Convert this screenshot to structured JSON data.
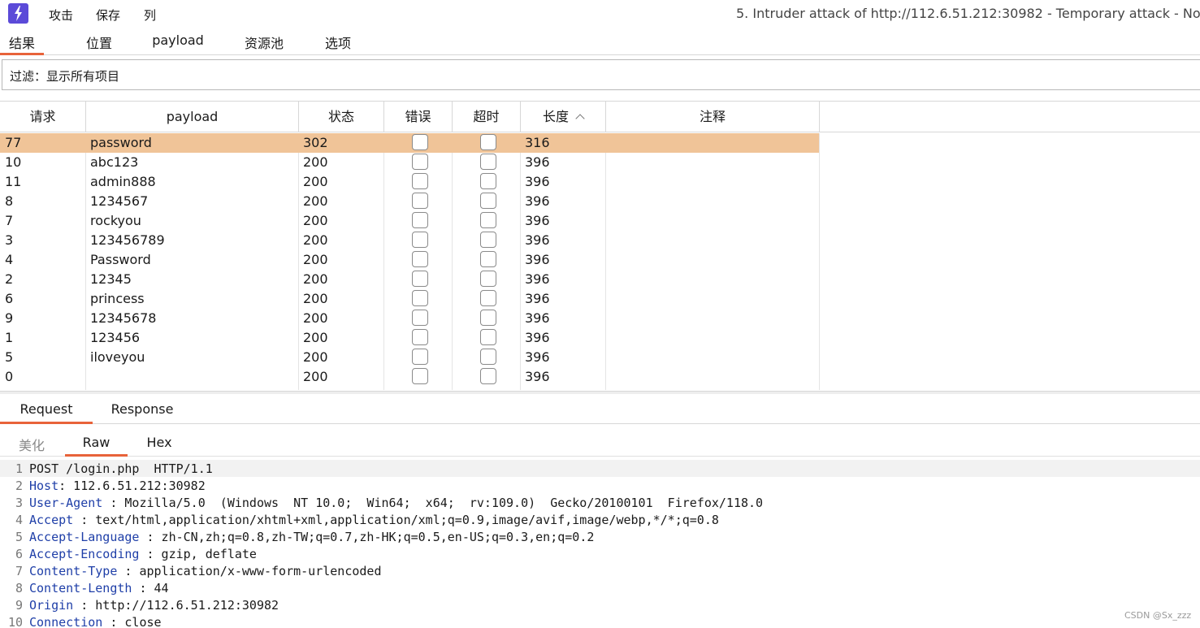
{
  "app": {
    "menu": [
      "攻击",
      "保存",
      "列"
    ],
    "window_title": "5. Intruder attack of http://112.6.51.212:30982 - Temporary attack - No"
  },
  "main_tabs": [
    "结果",
    "位置",
    "payload",
    "资源池",
    "选项"
  ],
  "filter": {
    "text": "过滤：显示所有项目"
  },
  "table": {
    "headers": [
      "请求",
      "payload",
      "状态",
      "错误",
      "超时",
      "长度",
      "注释"
    ],
    "rows": [
      {
        "request": "77",
        "payload": "password",
        "status": "302",
        "length": "316",
        "selected": true
      },
      {
        "request": "10",
        "payload": "abc123",
        "status": "200",
        "length": "396"
      },
      {
        "request": "11",
        "payload": "admin888",
        "status": "200",
        "length": "396"
      },
      {
        "request": "8",
        "payload": "1234567",
        "status": "200",
        "length": "396"
      },
      {
        "request": "7",
        "payload": "rockyou",
        "status": "200",
        "length": "396"
      },
      {
        "request": "3",
        "payload": "123456789",
        "status": "200",
        "length": "396"
      },
      {
        "request": "4",
        "payload": "Password",
        "status": "200",
        "length": "396"
      },
      {
        "request": "2",
        "payload": "12345",
        "status": "200",
        "length": "396"
      },
      {
        "request": "6",
        "payload": "princess",
        "status": "200",
        "length": "396"
      },
      {
        "request": "9",
        "payload": "12345678",
        "status": "200",
        "length": "396"
      },
      {
        "request": "1",
        "payload": "123456",
        "status": "200",
        "length": "396"
      },
      {
        "request": "5",
        "payload": "iloveyou",
        "status": "200",
        "length": "396"
      },
      {
        "request": "0",
        "payload": "",
        "status": "200",
        "length": "396"
      }
    ]
  },
  "rr_tabs": [
    "Request",
    "Response"
  ],
  "sub_tabs": [
    "美化",
    "Raw",
    "Hex"
  ],
  "raw_lines": [
    {
      "n": "1",
      "name": "",
      "value": "POST /login.php  HTTP/1.1"
    },
    {
      "n": "2",
      "name": "Host",
      "value": ": 112.6.51.212:30982"
    },
    {
      "n": "3",
      "name": "User-Agent",
      "value": " : Mozilla/5.0  (Windows  NT 10.0;  Win64;  x64;  rv:109.0)  Gecko/20100101  Firefox/118.0"
    },
    {
      "n": "4",
      "name": "Accept",
      "value": " : text/html,application/xhtml+xml,application/xml;q=0.9,image/avif,image/webp,*/*;q=0.8"
    },
    {
      "n": "5",
      "name": "Accept-Language",
      "value": " : zh-CN,zh;q=0.8,zh-TW;q=0.7,zh-HK;q=0.5,en-US;q=0.3,en;q=0.2"
    },
    {
      "n": "6",
      "name": "Accept-Encoding",
      "value": " : gzip, deflate"
    },
    {
      "n": "7",
      "name": "Content-Type",
      "value": " : application/x-www-form-urlencoded"
    },
    {
      "n": "8",
      "name": "Content-Length",
      "value": " : 44"
    },
    {
      "n": "9",
      "name": "Origin",
      "value": " : http://112.6.51.212:30982"
    },
    {
      "n": "10",
      "name": "Connection",
      "value": " : close"
    }
  ],
  "watermark": "CSDN @Sx_zzz",
  "colors": {
    "accent": "#e8633a",
    "selected_row": "#f0c498",
    "logo": "#5b4ad8",
    "header_name": "#1f3fa8"
  }
}
